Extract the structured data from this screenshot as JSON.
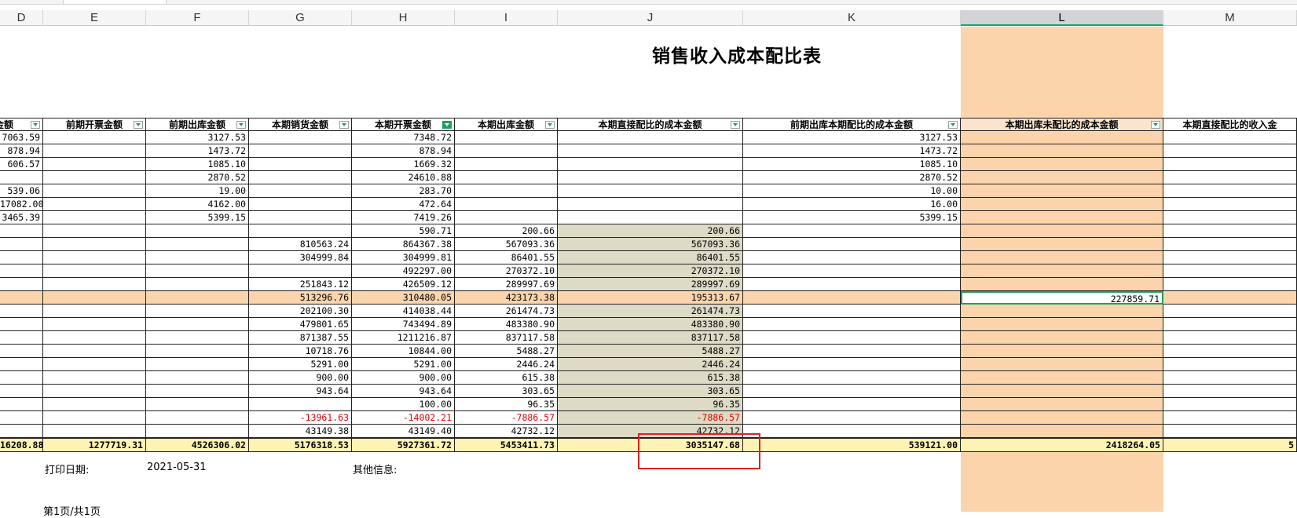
{
  "title": "销售收入成本配比表",
  "columns": [
    "D",
    "E",
    "F",
    "G",
    "H",
    "I",
    "J",
    "K",
    "L",
    "M"
  ],
  "headers": [
    "金额",
    "前期开票金额",
    "前期出库金额",
    "本期销货金额",
    "本期开票金额",
    "本期出库金额",
    "本期直接配比的成本金额",
    "前期出库本期配比的成本金额",
    "本期出库未配比的成本金额",
    "本期直接配比的收入金"
  ],
  "rows": [
    [
      "7063.59",
      "",
      "3127.53",
      "",
      "7348.72",
      "",
      "",
      "3127.53",
      "",
      ""
    ],
    [
      "878.94",
      "",
      "1473.72",
      "",
      "878.94",
      "",
      "",
      "1473.72",
      "",
      ""
    ],
    [
      "606.57",
      "",
      "1085.10",
      "",
      "1669.32",
      "",
      "",
      "1085.10",
      "",
      ""
    ],
    [
      "",
      "",
      "2870.52",
      "",
      "24610.88",
      "",
      "",
      "2870.52",
      "",
      ""
    ],
    [
      "539.06",
      "",
      "19.00",
      "",
      "283.70",
      "",
      "",
      "10.00",
      "",
      ""
    ],
    [
      "17082.00",
      "",
      "4162.00",
      "",
      "472.64",
      "",
      "",
      "16.00",
      "",
      ""
    ],
    [
      "3465.39",
      "",
      "5399.15",
      "",
      "7419.26",
      "",
      "",
      "5399.15",
      "",
      ""
    ],
    [
      "",
      "",
      "",
      "",
      "590.71",
      "200.66",
      "200.66",
      "",
      "",
      ""
    ],
    [
      "",
      "",
      "",
      "810563.24",
      "864367.38",
      "567093.36",
      "567093.36",
      "",
      "",
      ""
    ],
    [
      "",
      "",
      "",
      "304999.84",
      "304999.81",
      "86401.55",
      "86401.55",
      "",
      "",
      ""
    ],
    [
      "",
      "",
      "",
      "",
      "492297.00",
      "270372.10",
      "270372.10",
      "",
      "",
      ""
    ],
    [
      "",
      "",
      "",
      "251843.12",
      "426509.12",
      "289997.69",
      "289997.69",
      "",
      "",
      ""
    ],
    [
      "",
      "",
      "",
      "513296.76",
      "310480.05",
      "423173.38",
      "195313.67",
      "",
      "227859.71",
      ""
    ],
    [
      "",
      "",
      "",
      "202100.30",
      "414038.44",
      "261474.73",
      "261474.73",
      "",
      "",
      ""
    ],
    [
      "",
      "",
      "",
      "479801.65",
      "743494.89",
      "483380.90",
      "483380.90",
      "",
      "",
      ""
    ],
    [
      "",
      "",
      "",
      "871387.55",
      "1211216.87",
      "837117.58",
      "837117.58",
      "",
      "",
      ""
    ],
    [
      "",
      "",
      "",
      "10718.76",
      "10844.00",
      "5488.27",
      "5488.27",
      "",
      "",
      ""
    ],
    [
      "",
      "",
      "",
      "5291.00",
      "5291.00",
      "2446.24",
      "2446.24",
      "",
      "",
      ""
    ],
    [
      "",
      "",
      "",
      "900.00",
      "900.00",
      "615.38",
      "615.38",
      "",
      "",
      ""
    ],
    [
      "",
      "",
      "",
      "943.64",
      "943.64",
      "303.65",
      "303.65",
      "",
      "",
      ""
    ],
    [
      "",
      "",
      "",
      "",
      "100.00",
      "96.35",
      "96.35",
      "",
      "",
      ""
    ],
    [
      "",
      "",
      "",
      "-13961.63",
      "-14002.21",
      "-7886.57",
      "-7886.57",
      "",
      "",
      ""
    ],
    [
      "",
      "",
      "",
      "43149.38",
      "43149.40",
      "42732.12",
      "42732.12",
      "",
      "",
      ""
    ]
  ],
  "totals": [
    "16208.88",
    "1277719.31",
    "4526306.02",
    "5176318.53",
    "5927361.72",
    "5453411.73",
    "3035147.68",
    "539121.00",
    "2418264.05",
    "5"
  ],
  "footer": {
    "print_date_label": "打印日期:",
    "print_date": "2021-05-31",
    "other_label": "其他信息:",
    "page": "第1页/共1页"
  },
  "colors": {
    "accent": "#1e9e63",
    "highlight": "#fcd4ac",
    "total_fill": "#fef3b4",
    "negative": "#e00000",
    "annotation": "#e02020"
  }
}
